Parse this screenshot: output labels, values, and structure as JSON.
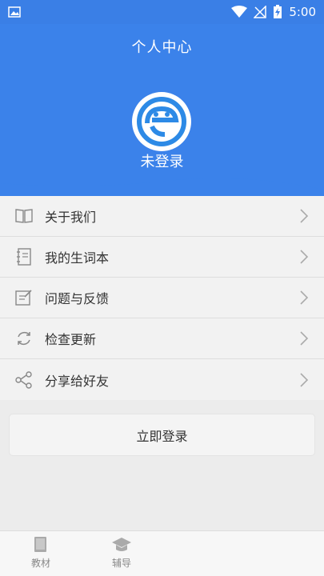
{
  "status_bar": {
    "time": "5:00"
  },
  "header": {
    "title": "个人中心",
    "login_status": "未登录",
    "colors": {
      "accent": "#3b82ea"
    }
  },
  "menu": {
    "items": [
      {
        "label": "关于我们",
        "icon": "book-icon"
      },
      {
        "label": "我的生词本",
        "icon": "notebook-icon"
      },
      {
        "label": "问题与反馈",
        "icon": "feedback-edit-icon"
      },
      {
        "label": "检查更新",
        "icon": "refresh-icon"
      },
      {
        "label": "分享给好友",
        "icon": "share-icon"
      }
    ]
  },
  "login_button": {
    "label": "立即登录"
  },
  "bottom_nav": {
    "tabs": [
      {
        "label": "教材",
        "icon": "textbook-icon"
      },
      {
        "label": "辅导",
        "icon": "graduation-cap-icon"
      }
    ]
  }
}
